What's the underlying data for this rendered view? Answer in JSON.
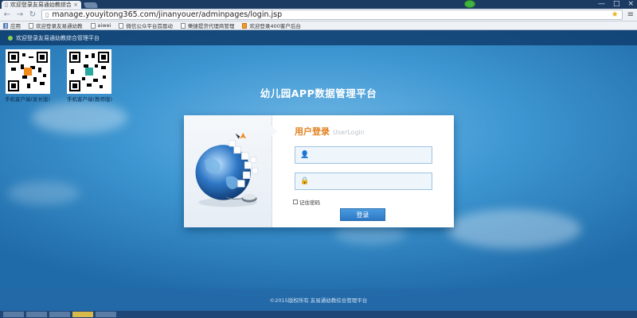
{
  "browser": {
    "tab_title": "欢迎登录友易通幼教综合",
    "tab_close": "×",
    "url": "manage.youyitong365.com/jinanyouer/adminpages/login.jsp",
    "back_icon": "arrow-left-icon",
    "forward_icon": "arrow-right-icon",
    "reload_icon": "reload-icon",
    "star_icon": "star-icon",
    "menu_icon": "menu-icon",
    "win_min": "—",
    "win_max": "□",
    "win_close": "×"
  },
  "bookmarks": [
    {
      "label": "应用"
    },
    {
      "label": "欢迎登录友易通幼教"
    },
    {
      "label": "aiwei"
    },
    {
      "label": "微信公众平台首届动"
    },
    {
      "label": "樂捷提货代理商管理"
    },
    {
      "label": "欢迎登录400客户后台"
    }
  ],
  "page": {
    "strip_text": "欢迎登录友易通幼教综合管理平台",
    "title": "幼儿园APP数据管理平台",
    "qr_codes": [
      {
        "caption": "手机客户端(家长版)"
      },
      {
        "caption": "手机客户端(教师版)"
      }
    ],
    "login": {
      "heading_zh": "用户登录",
      "heading_en": "UserLogin",
      "username_value": "",
      "password_value": "",
      "remember_label": "记住密码",
      "submit_label": "登录"
    },
    "footer": "©2015版权所有 友易通幼教综合管理平台"
  },
  "colors": {
    "accent": "#2d78c4",
    "heading_orange": "#e2811f",
    "page_blue": "#3d96d1"
  }
}
